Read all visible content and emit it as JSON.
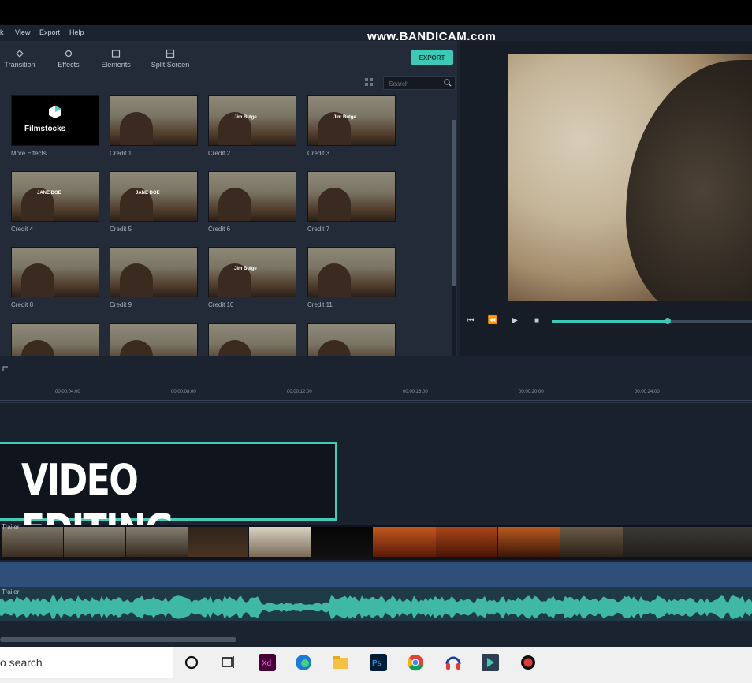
{
  "watermark": "www.BANDICAM.com",
  "menu": [
    "k",
    "View",
    "Export",
    "Help"
  ],
  "toolbar": {
    "tools": [
      {
        "label": "Transition",
        "icon": "transition-icon"
      },
      {
        "label": "Effects",
        "icon": "effects-icon"
      },
      {
        "label": "Elements",
        "icon": "elements-icon"
      },
      {
        "label": "Split Screen",
        "icon": "split-screen-icon"
      }
    ],
    "export_label": "EXPORT"
  },
  "search": {
    "placeholder": "Search"
  },
  "effects": [
    {
      "label": "More Effects",
      "overlay": "Filmstocks"
    },
    {
      "label": "Credit 1",
      "overlay": ""
    },
    {
      "label": "Credit 2",
      "overlay": "Jim Bulge"
    },
    {
      "label": "Credit 3",
      "overlay": "Jim Bulge"
    },
    {
      "label": "Credit 4",
      "overlay": "JANE DOE"
    },
    {
      "label": "Credit 5",
      "overlay": "JANE DOE"
    },
    {
      "label": "Credit 6",
      "overlay": ""
    },
    {
      "label": "Credit 7",
      "overlay": ""
    },
    {
      "label": "Credit 8",
      "overlay": ""
    },
    {
      "label": "Credit 9",
      "overlay": ""
    },
    {
      "label": "Credit 10",
      "overlay": "Jim Bulge"
    },
    {
      "label": "Credit 11",
      "overlay": ""
    },
    {
      "label": "",
      "overlay": ""
    },
    {
      "label": "",
      "overlay": ""
    },
    {
      "label": "",
      "overlay": ""
    },
    {
      "label": "",
      "overlay": ""
    }
  ],
  "player": {
    "progress": 0.58
  },
  "ruler": [
    "00:00:04:00",
    "00:00:08:00",
    "00:00:12:00",
    "00:00:16:00",
    "00:00:20:00",
    "00:00:24:00"
  ],
  "title_card": "VIDEO EDITING",
  "tracks": {
    "video_label": "Trailer",
    "audio_label": "Trailer"
  },
  "taskbar": {
    "search_text": "o search",
    "icons": [
      "cortana-icon",
      "task-view-icon",
      "xd-icon",
      "edge-icon",
      "file-explorer-icon",
      "photoshop-icon",
      "chrome-icon",
      "audio-app-icon",
      "filmora-icon",
      "record-icon"
    ]
  }
}
